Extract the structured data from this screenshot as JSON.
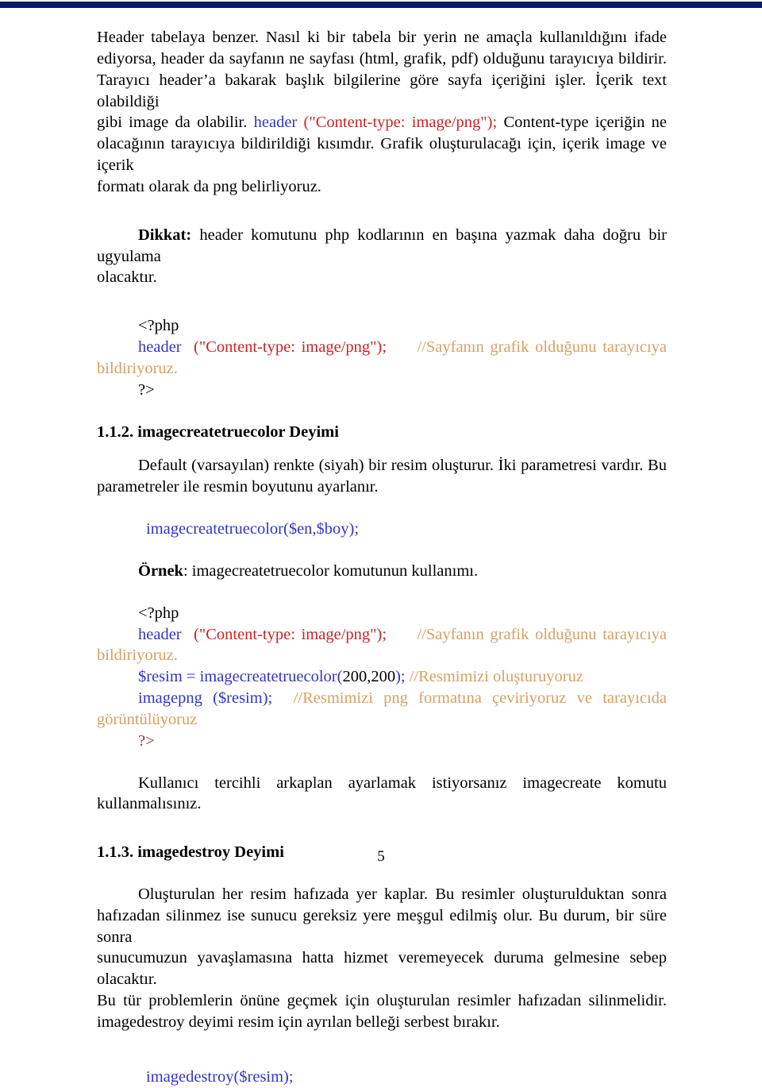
{
  "document": {
    "page_number": "5",
    "top_rule_color": "#0c1b62",
    "colors": {
      "keyword": "#3333cc",
      "string": "#cc2222",
      "comment": "#d8a062",
      "text": "#000000"
    }
  },
  "intro": {
    "line1": "Header tabelaya benzer. Nasıl ki bir tabela bir yerin ne amaçla kullanıldığını ifade",
    "line2": "ediyorsa, header da sayfanın ne sayfası (html, grafik, pdf) olduğunu tarayıcıya bildirir.",
    "line3": "Tarayıcı header’a bakarak başlık bilgilerine göre sayfa içeriğini işler. İçerik text olabildiği",
    "line4_a": "gibi image da olabilir. ",
    "line4_kw": "header",
    "line4_str": " (\"Content-type: image/png\");",
    "line4_b": " Content-type içeriğin ne",
    "line5": "olacağının tarayıcıya bildirildiği kısımdır. Grafik oluşturulacağı için, içerik image ve içerik",
    "line6": "formatı olarak da png belirliyoruz."
  },
  "dikkat": {
    "label": "Dikkat:",
    "text": " header komutunu php kodlarının en başına yazmak daha doğru bir ugyulama",
    "text2": "olacaktır."
  },
  "code1": {
    "open_tag": "<?php",
    "keyword": "header",
    "string": "(\"Content-type: image/png\");",
    "comment": "//Sayfanın grafik olduğunu tarayıcıya",
    "comment_wrap": "bildiriyoruz.",
    "close_tag": "?>"
  },
  "section_112": {
    "heading": "1.1.2. imagecreatetruecolor Deyimi",
    "para_line1": "Default (varsayılan) renkte (siyah) bir resim oluşturur. İki parametresi vardır. Bu",
    "para_line2": "parametreler ile resmin boyutunu ayarlanır.",
    "signature": "imagecreatetruecolor($en,$boy);",
    "ornek_label": "Örnek",
    "ornek_text": ": imagecreatetruecolor komutunun kullanımı."
  },
  "code2": {
    "open_tag": "<?php",
    "keyword": "header",
    "string": "(\"Content-type: image/png\");",
    "comment": "//Sayfanın grafik olduğunu tarayıcıya",
    "comment_wrap": "bildiriyoruz.",
    "line_resim_kw": "$resim = imagecreatetruecolor(",
    "line_resim_args": "200,200",
    "line_resim_kw2": ");",
    "line_resim_cmt": " //Resmimizi oluşturuyoruz",
    "line_imagepng_kw": "imagepng ($resim);",
    "line_imagepng_cmt": "//Resmimizi png formatına çeviriyoruz ve tarayıcıda",
    "line_imagepng_cmt_wrap": "görüntülüyoruz",
    "close_tag": "?>"
  },
  "kullanici": {
    "line1": "Kullanıcı tercihli arkaplan ayarlamak istiyorsanız imagecreate komutu",
    "line2": "kullanmalısınız."
  },
  "section_113": {
    "heading": "1.1.3. imagedestroy Deyimi",
    "para_line1": "Oluşturulan her resim hafızada yer kaplar. Bu resimler oluşturulduktan sonra",
    "para_line2": "hafızadan silinmez  ise sunucu gereksiz yere meşgul edilmiş olur. Bu durum, bir süre sonra",
    "para_line3": "sunucumuzun yavaşlamasına hatta hizmet veremeyecek duruma gelmesine sebep olacaktır.",
    "para_line4": "Bu tür problemlerin önüne geçmek için oluşturulan resimler hafızadan silinmelidir.",
    "para_line5": "imagedestroy deyimi resim için ayrılan belleği serbest bırakır.",
    "signature": "imagedestroy($resim);"
  }
}
